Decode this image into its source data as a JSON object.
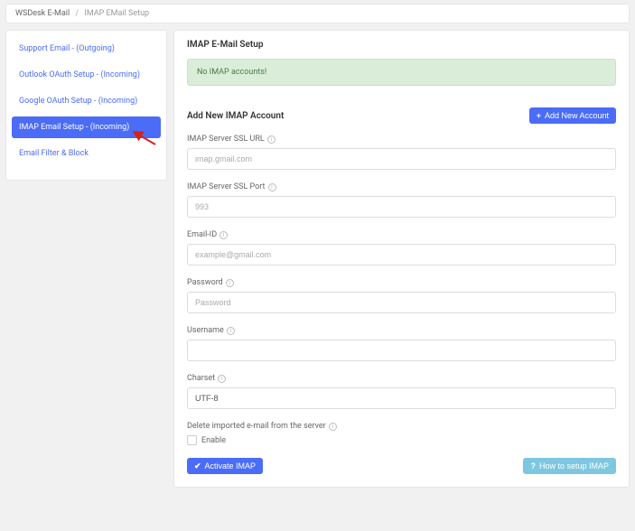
{
  "breadcrumb": {
    "root": "WSDesk E-Mail",
    "current": "IMAP EMail Setup"
  },
  "sidebar": {
    "items": [
      {
        "label": "Support Email - (Outgoing)"
      },
      {
        "label": "Outlook OAuth Setup - (Incoming)"
      },
      {
        "label": "Google OAuth Setup - (Incoming)"
      },
      {
        "label": "IMAP Email Setup - (Incoming)"
      },
      {
        "label": "Email Filter & Block"
      }
    ],
    "active_index": 3
  },
  "panel": {
    "heading": "IMAP E-Mail Setup",
    "alert": "No IMAP accounts!",
    "add_new_button": "Add New Account",
    "subheading": "Add New IMAP Account",
    "fields": {
      "ssl_url": {
        "label": "IMAP Server SSL URL",
        "placeholder": "imap.gmail.com",
        "value": ""
      },
      "ssl_port": {
        "label": "IMAP Server SSL Port",
        "placeholder": "993",
        "value": ""
      },
      "email": {
        "label": "Email-ID",
        "placeholder": "example@gmail.com",
        "value": ""
      },
      "password": {
        "label": "Password",
        "placeholder": "Password",
        "value": ""
      },
      "username": {
        "label": "Username",
        "placeholder": "",
        "value": ""
      },
      "charset": {
        "label": "Charset",
        "placeholder": "",
        "value": "UTF-8"
      },
      "delete_mail": {
        "label": "Delete imported e-mail from the server",
        "checkbox_label": "Enable",
        "checked": false
      }
    },
    "activate_button": "Activate IMAP",
    "help_button": "How to setup IMAP"
  },
  "colors": {
    "primary": "#4a6cf7",
    "info": "#7ec7e0",
    "alert_bg": "#d9edd9",
    "arrow": "#d62020"
  }
}
